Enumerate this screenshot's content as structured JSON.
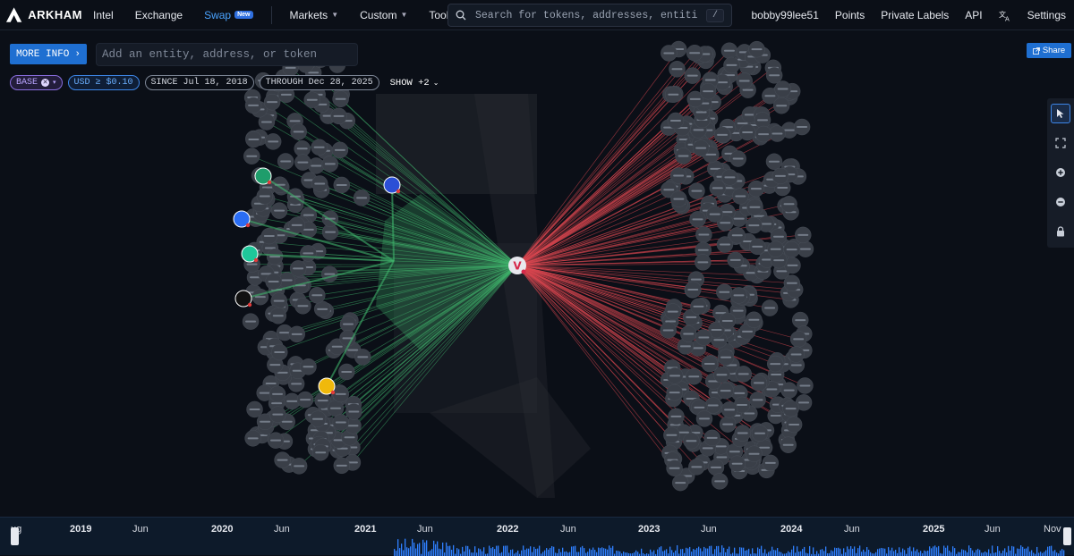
{
  "brand": {
    "name": "ARKHAM"
  },
  "nav": {
    "left": [
      {
        "label": "Intel"
      },
      {
        "label": "Exchange"
      },
      {
        "label": "Swap",
        "badge": "New"
      }
    ],
    "menus": [
      {
        "label": "Markets"
      },
      {
        "label": "Custom"
      },
      {
        "label": "Tools"
      }
    ],
    "search": {
      "placeholder": "Search for tokens, addresses, entities...",
      "shortcut": "/"
    },
    "right": [
      {
        "label": "bobby99lee51"
      },
      {
        "label": "Points"
      },
      {
        "label": "Private Labels"
      },
      {
        "label": "API"
      },
      {
        "label": "Settings"
      }
    ]
  },
  "toolbar": {
    "more_info": "MORE INFO",
    "entity_placeholder": "Add an entity, address, or token",
    "share": "Share"
  },
  "filters": {
    "chain": "BASE",
    "usd": "USD ≥ $0.10",
    "since": "SINCE Jul 18, 2018",
    "through": "THROUGH Dec 28, 2025",
    "show_more": "SHOW +2"
  },
  "tools": [
    {
      "icon": "pointer-icon"
    },
    {
      "icon": "fit-view-icon"
    },
    {
      "icon": "zoom-in-icon"
    },
    {
      "icon": "zoom-out-icon"
    },
    {
      "icon": "lock-icon"
    }
  ],
  "graph": {
    "center_entity": "V",
    "colors": {
      "inflow": "#3fb36b",
      "outflow": "#d9464f",
      "node": "#3a3f48",
      "center": "#e8e8ee"
    },
    "entities_left": [
      {
        "icon": "delta-icon"
      },
      {
        "icon": "coinbase-icon"
      },
      {
        "icon": "kucoin-icon"
      },
      {
        "icon": "okx-icon"
      },
      {
        "icon": "binance-icon"
      },
      {
        "icon": "rocket-icon"
      }
    ]
  },
  "timeline": {
    "labels": [
      {
        "text": "ug",
        "year": false
      },
      {
        "text": "2019",
        "year": true
      },
      {
        "text": "Jun",
        "year": false
      },
      {
        "text": "2020",
        "year": true
      },
      {
        "text": "Jun",
        "year": false
      },
      {
        "text": "2021",
        "year": true
      },
      {
        "text": "Jun",
        "year": false
      },
      {
        "text": "2022",
        "year": true
      },
      {
        "text": "Jun",
        "year": false
      },
      {
        "text": "2023",
        "year": true
      },
      {
        "text": "Jun",
        "year": false
      },
      {
        "text": "2024",
        "year": true
      },
      {
        "text": "Jun",
        "year": false
      },
      {
        "text": "2025",
        "year": true
      },
      {
        "text": "Jun",
        "year": false
      },
      {
        "text": "Nov",
        "year": false
      }
    ]
  }
}
